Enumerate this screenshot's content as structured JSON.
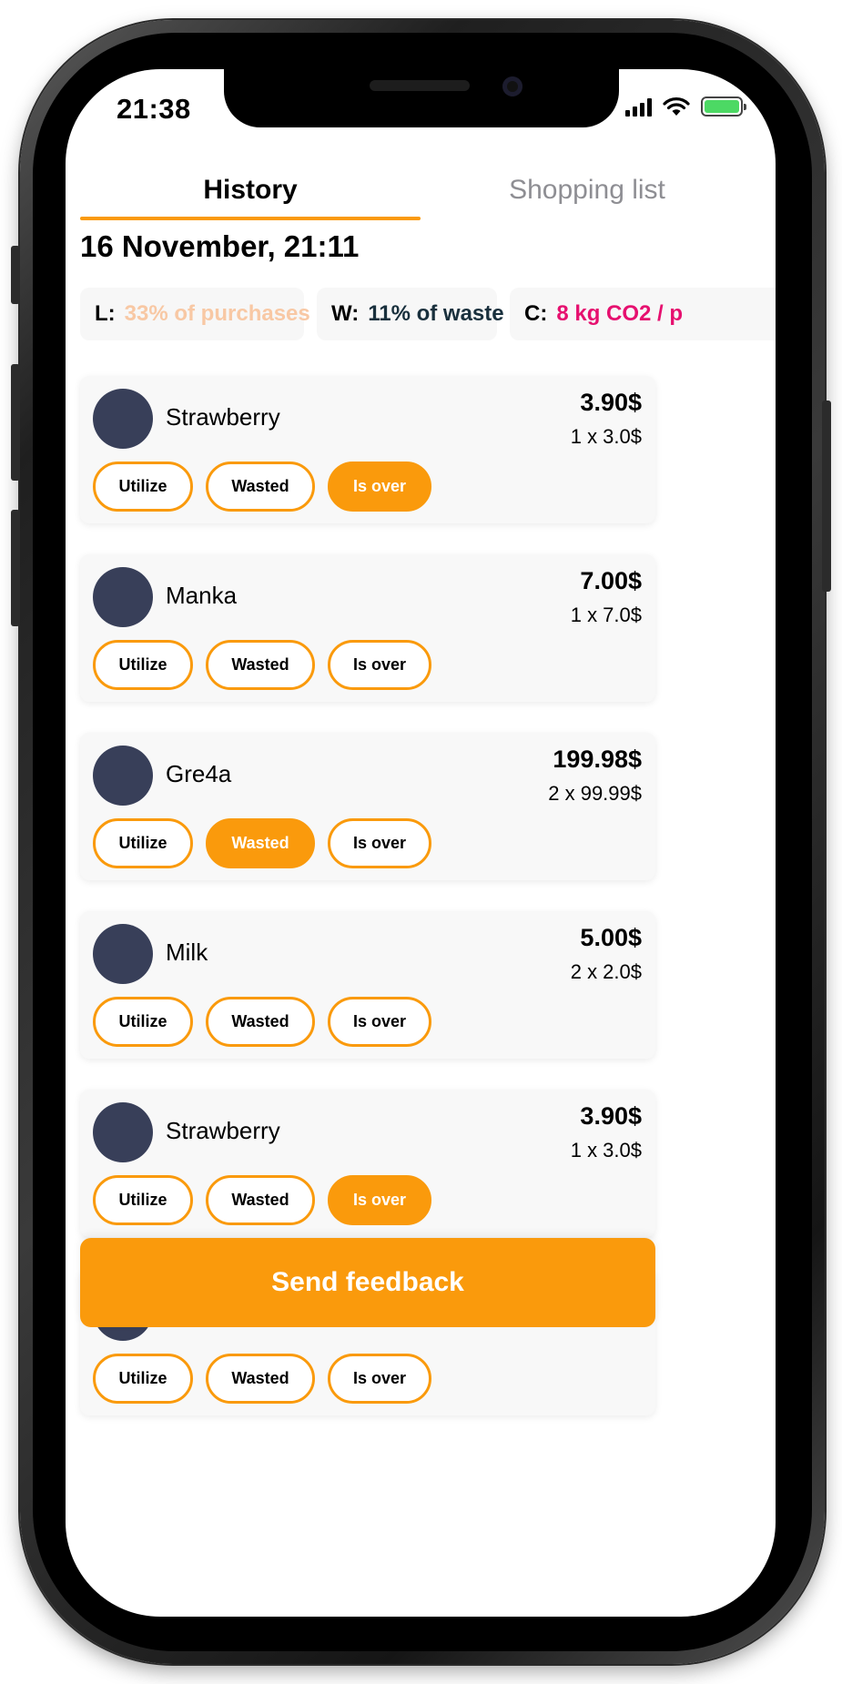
{
  "status_bar": {
    "time": "21:38"
  },
  "tabs": [
    {
      "label": "History",
      "active": true
    },
    {
      "label": "Shopping list",
      "active": false
    }
  ],
  "date": "16 November, 21:11",
  "stats": [
    {
      "key": "L:",
      "value": "33% of purchases",
      "color": "#f8c8a4"
    },
    {
      "key": "W:",
      "value": "11% of waste",
      "color": "#19303d"
    },
    {
      "key": "C:",
      "value": "8 kg CO2 / p",
      "color": "#e6106f"
    }
  ],
  "action_labels": {
    "utilize": "Utilize",
    "wasted": "Wasted",
    "is_over": "Is over"
  },
  "items": [
    {
      "name": "Strawberry",
      "total": "3.90$",
      "quantity": "1 x 3.0$",
      "selected": "is_over"
    },
    {
      "name": "Manka",
      "total": "7.00$",
      "quantity": "1 x 7.0$",
      "selected": ""
    },
    {
      "name": "Gre4a",
      "total": "199.98$",
      "quantity": "2 x 99.99$",
      "selected": "wasted"
    },
    {
      "name": "Milk",
      "total": "5.00$",
      "quantity": "2 x 2.0$",
      "selected": ""
    },
    {
      "name": "Strawberry",
      "total": "3.90$",
      "quantity": "1 x 3.0$",
      "selected": "is_over"
    },
    {
      "name": "",
      "total": "",
      "quantity": "",
      "selected": ""
    }
  ],
  "feedback_label": "Send feedback",
  "colors": {
    "accent": "#fa9a0c",
    "avatar": "#383f59",
    "battery": "#4cd964"
  }
}
